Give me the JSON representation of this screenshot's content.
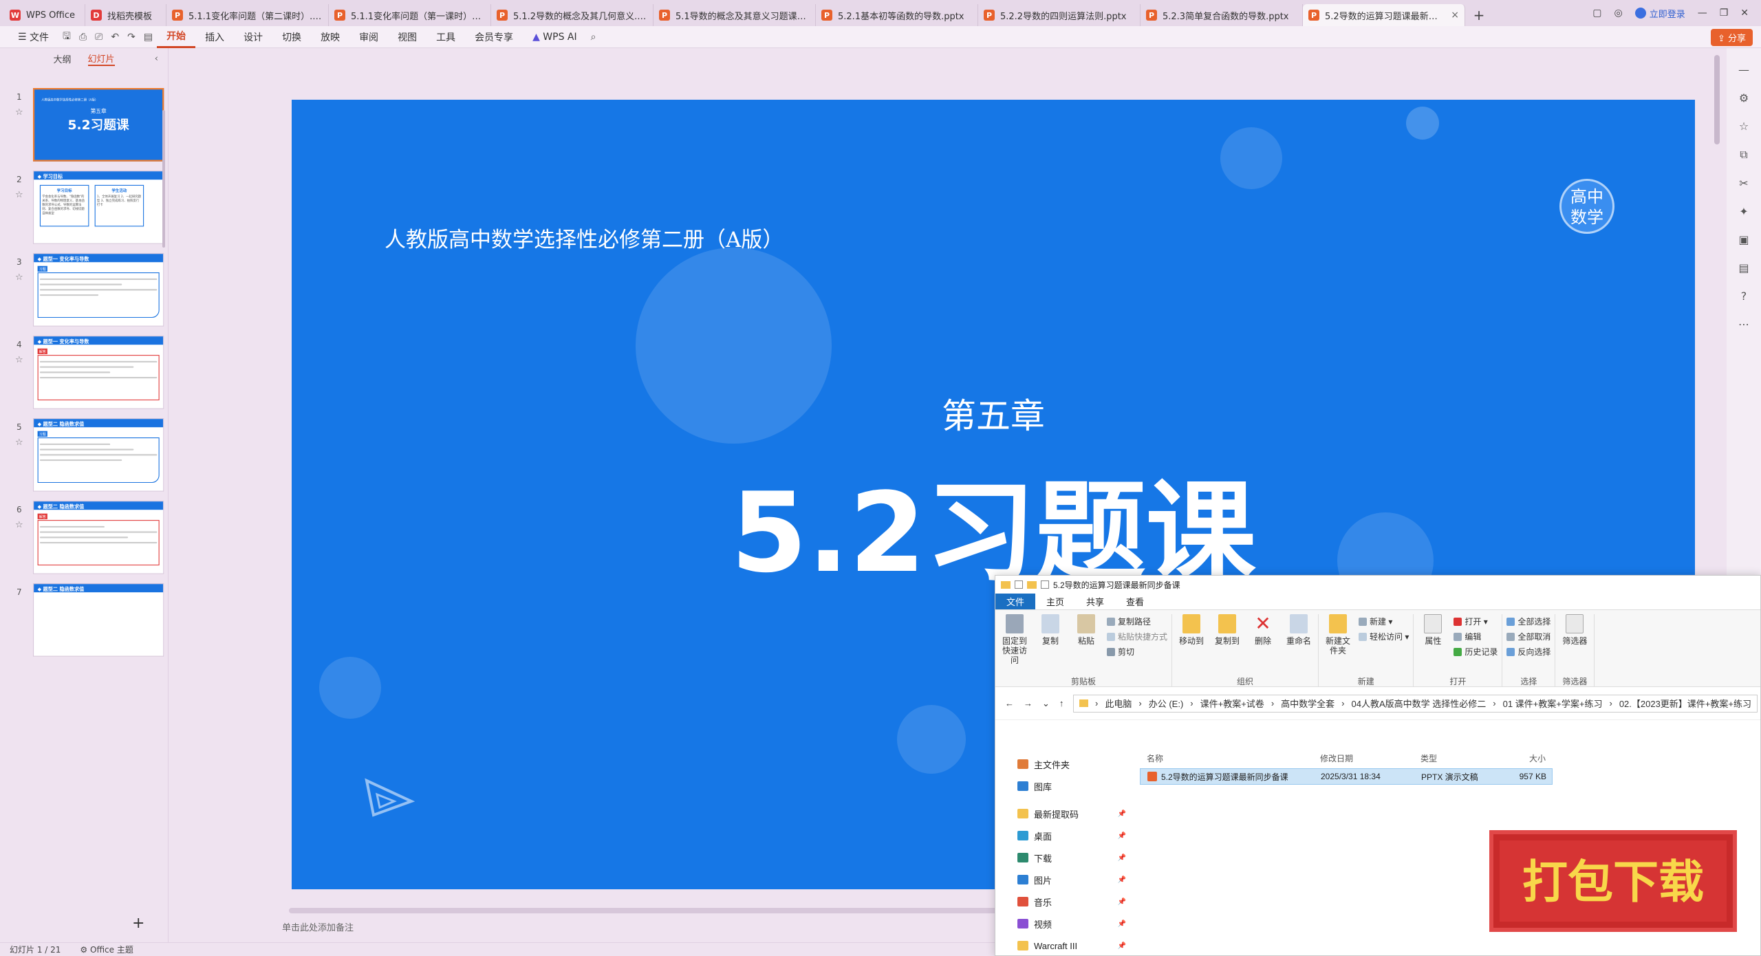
{
  "tabs": [
    {
      "label": "WPS Office",
      "icon": "wps-icon",
      "color": "#e23b3b"
    },
    {
      "label": "找稻壳模板",
      "icon": "docer-icon",
      "color": "#e23b3b"
    },
    {
      "label": "5.1.1变化率问题（第二课时）.pptx",
      "icon": "ppt-icon",
      "color": "#e8612c"
    },
    {
      "label": "5.1.1变化率问题（第一课时）（课件...",
      "icon": "ppt-icon",
      "color": "#e8612c"
    },
    {
      "label": "5.1.2导数的概念及其几何意义.pptx",
      "icon": "ppt-icon",
      "color": "#e8612c"
    },
    {
      "label": "5.1导数的概念及其意义习题课最新同...",
      "icon": "ppt-icon",
      "color": "#e8612c"
    },
    {
      "label": "5.2.1基本初等函数的导数.pptx",
      "icon": "ppt-icon",
      "color": "#e8612c"
    },
    {
      "label": "5.2.2导数的四则运算法则.pptx",
      "icon": "ppt-icon",
      "color": "#e8612c"
    },
    {
      "label": "5.2.3简单复合函数的导数.pptx",
      "icon": "ppt-icon",
      "color": "#e8612c"
    },
    {
      "label": "5.2导数的运算习题课最新同...",
      "icon": "ppt-icon",
      "color": "#e8612c"
    }
  ],
  "login": "立即登录",
  "ribbon": {
    "file": "文件",
    "items": [
      "开始",
      "插入",
      "设计",
      "切换",
      "放映",
      "审阅",
      "视图",
      "工具",
      "会员专享"
    ],
    "wps_ai": "WPS AI",
    "share": "分享"
  },
  "left_panel": {
    "outline": "大纲",
    "slides": "幻灯片"
  },
  "thumbs": [
    {
      "num": "1",
      "sub": "人教版高中数学选择性必修第二册（A版）",
      "t1": "第五章",
      "t2": "5.2习题课"
    },
    {
      "num": "2",
      "head": "◆ 学习目标",
      "card1_title": "学习目标",
      "card1": "学会会化率与导数、\"隐函数\"的关系、导数的物理意义、基本函数的求导公式、导数的运算法则、复合函数的求导、切线切题目种类型",
      "card2_title": "学生活动",
      "card2": "1、全体开展复习 2、一起研究题型 3、独立完成练习、拍照反行打卡"
    },
    {
      "num": "3",
      "head": "◆ 题型一 变化率与导数",
      "tag": "习题"
    },
    {
      "num": "4",
      "head": "◆ 题型一 变化率与导数",
      "tag": "解答"
    },
    {
      "num": "5",
      "head": "◆ 题型二 隐函数求值",
      "tag": "习题"
    },
    {
      "num": "6",
      "head": "◆ 题型二 隐函数求值",
      "tag": "解答"
    },
    {
      "num": "7",
      "head": "◆ 题型二 隐函数求值"
    }
  ],
  "slide": {
    "subtitle": "人教版高中数学选择性必修第二册（A版）",
    "chapter": "第五章",
    "title": "5.2习题课",
    "badge_line1": "高中",
    "badge_line2": "数学"
  },
  "notes_placeholder": "单击此处添加备注",
  "status": {
    "slide_count": "幻灯片 1 / 21",
    "theme": "Office 主题"
  },
  "explorer": {
    "title": "5.2导数的运算习题课最新同步备课",
    "tabs": [
      "文件",
      "主页",
      "共享",
      "查看"
    ],
    "groups": [
      {
        "name": "剪贴板",
        "big": [
          "固定到快速访问",
          "复制",
          "粘贴"
        ],
        "small": [
          "复制路径",
          "粘贴快捷方式",
          "剪切"
        ]
      },
      {
        "name": "组织",
        "big": [
          "移动到",
          "复制到",
          "删除",
          "重命名"
        ]
      },
      {
        "name": "新建",
        "big": [
          "新建文件夹"
        ],
        "small": [
          "新建 ▾",
          "轻松访问 ▾"
        ]
      },
      {
        "name": "打开",
        "big": [
          "属性"
        ],
        "small": [
          "打开 ▾",
          "编辑",
          "历史记录"
        ]
      },
      {
        "name": "选择",
        "small": [
          "全部选择",
          "全部取消",
          "反向选择"
        ]
      },
      {
        "name": "筛选器",
        "big": [
          "筛选器"
        ]
      }
    ],
    "path": [
      "此电脑",
      "办公 (E:)",
      "课件+教案+试卷",
      "高中数学全套",
      "04人教A版高中数学 选择性必修二",
      "01 课件+教案+学案+练习",
      "02.【2023更新】课件+教案+练习"
    ],
    "nav": [
      {
        "label": "主文件夹",
        "icon": "home-icon",
        "color": "#e07b39"
      },
      {
        "label": "图库",
        "icon": "gallery-icon",
        "color": "#2d7fd3"
      },
      {
        "label": "最新提取码",
        "icon": "folder-icon",
        "color": "#f3c24e",
        "pin": true
      },
      {
        "label": "桌面",
        "icon": "desktop-icon",
        "color": "#2d9bd3",
        "pin": true
      },
      {
        "label": "下载",
        "icon": "download-icon",
        "color": "#2d8a6e",
        "pin": true
      },
      {
        "label": "图片",
        "icon": "pictures-icon",
        "color": "#2d7fd3",
        "pin": true
      },
      {
        "label": "音乐",
        "icon": "music-icon",
        "color": "#e0513c",
        "pin": true
      },
      {
        "label": "视频",
        "icon": "video-icon",
        "color": "#8a4fd3",
        "pin": true
      },
      {
        "label": "Warcraft III",
        "icon": "folder-icon",
        "color": "#f3c24e",
        "pin": true
      }
    ],
    "columns": [
      "名称",
      "修改日期",
      "类型",
      "大小"
    ],
    "files": [
      {
        "name": "5.2导数的运算习题课最新同步备课",
        "date": "2025/3/31 18:34",
        "type": "PPTX 演示文稿",
        "size": "957 KB"
      }
    ]
  },
  "download_badge": "打包下载"
}
